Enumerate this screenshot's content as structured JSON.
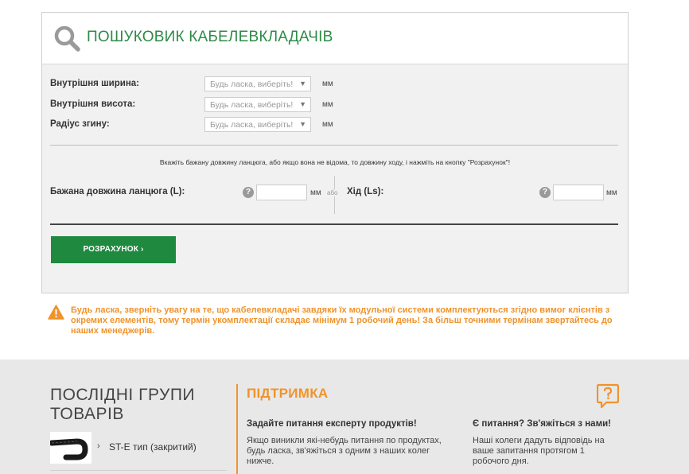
{
  "finder": {
    "title": "ПОШУКОВИК КАБЕЛЕВКЛАДАЧІВ",
    "rows": [
      {
        "label": "Внутрішня ширина:",
        "placeholder": "Будь ласка, виберіть!",
        "unit": "мм"
      },
      {
        "label": "Внутрішня висота:",
        "placeholder": "Будь ласка, виберіть!",
        "unit": "мм"
      },
      {
        "label": "Радіус згину:",
        "placeholder": "Будь ласка, виберіть!",
        "unit": "мм"
      }
    ],
    "hint": "Вкажіть бажану довжину ланцюга, або якщо вона не відома, то довжину ходу, і нажміть на кнопку \"Розрахунок\"!",
    "length_label": "Бажана довжина ланцюга (L):",
    "length_unit": "мм",
    "or_text": "або",
    "travel_label": "Хід (Ls):",
    "travel_unit": "мм",
    "help_glyph": "?",
    "calc_button": "РОЗРАХУНОК ›"
  },
  "warning": {
    "text": "Будь ласка, зверніть увагу на те, що кабелевкладачі завдяки їх модульної системи комплектуються згідно вимог клієнтів з окремих елементів, тому термін укомплектації складає мінімум 1 робочий день! За більш точними термінам звертайтесь до наших менеджерів."
  },
  "footer": {
    "recent_title": "ПОСЛІДНІ ГРУПИ ТОВАРІВ",
    "recent_item": "ST-E тип (закритий)",
    "recent_chevron": "›",
    "support_title": "ПІДТРИМКА",
    "support_col1_heading": "Задайте питання експерту продуктів!",
    "support_col1_text": "Якщо виникли які-небудь питання по продуктах, будь ласка, зв'яжіться з одним з наших колег нижче.",
    "support_col2_heading": "Є питання? Зв'яжіться з нами!",
    "support_col2_text": "Наші колеги дадуть відповідь на ваше запитання протягом 1 робочого дня."
  },
  "colors": {
    "brand_green": "#2e8b47",
    "button_green": "#1f8a3f",
    "accent_orange": "#f0932b"
  }
}
